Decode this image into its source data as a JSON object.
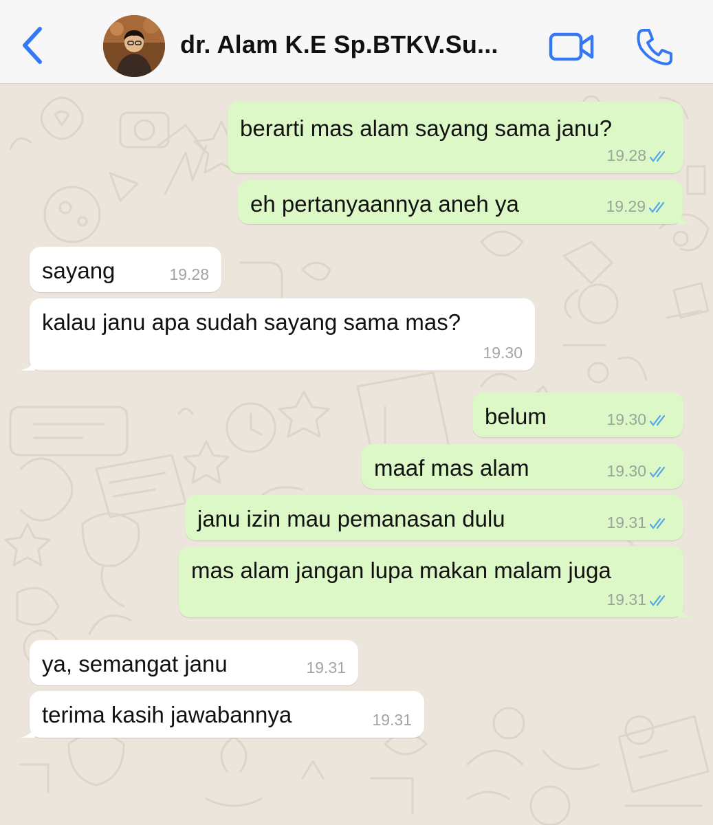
{
  "header": {
    "contact_name": "dr. Alam K.E Sp.BTKV.Su...",
    "back_icon": "chevron-left-icon",
    "video_icon": "video-camera-icon",
    "call_icon": "phone-icon"
  },
  "colors": {
    "accent": "#3478f6",
    "outgoing_bubble": "#dcf8c6",
    "incoming_bubble": "#ffffff",
    "read_ticks": "#4fa6e8",
    "wallpaper": "#ece5dc"
  },
  "messages": [
    {
      "direction": "out",
      "text": "berarti mas alam sayang sama janu?",
      "time": "19.28",
      "status": "read"
    },
    {
      "direction": "out",
      "text": "eh pertanyaannya aneh ya",
      "time": "19.29",
      "status": "read"
    },
    {
      "direction": "in",
      "text": "sayang",
      "time": "19.28"
    },
    {
      "direction": "in",
      "text": "kalau janu apa sudah sayang sama mas?",
      "time": "19.30"
    },
    {
      "direction": "out",
      "text": "belum",
      "time": "19.30",
      "status": "read"
    },
    {
      "direction": "out",
      "text": "maaf mas alam",
      "time": "19.30",
      "status": "read"
    },
    {
      "direction": "out",
      "text": "janu izin mau pemanasan dulu",
      "time": "19.31",
      "status": "read"
    },
    {
      "direction": "out",
      "text": "mas alam jangan lupa makan malam juga",
      "time": "19.31",
      "status": "read"
    },
    {
      "direction": "in",
      "text": "ya, semangat janu",
      "time": "19.31"
    },
    {
      "direction": "in",
      "text": "terima kasih jawabannya",
      "time": "19.31"
    }
  ]
}
